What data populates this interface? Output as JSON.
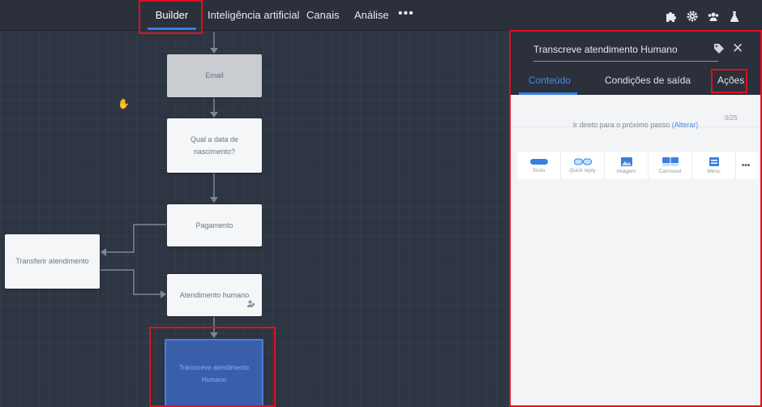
{
  "nav": {
    "items": [
      "Builder",
      "Inteligência artificial",
      "Canais",
      "Análise"
    ],
    "more": "•••",
    "icons": [
      "puzzle-icon",
      "gear-icon",
      "users-icon",
      "flask-icon"
    ]
  },
  "canvas": {
    "nodes": {
      "email": "Email",
      "nascimento": "Qual a data de nascimento?",
      "pagamento": "Pagamento",
      "transferir": "Transferir atendimento",
      "atendimento": "Atendimento humano",
      "transcreve": "Transcreve atendimento Humano"
    }
  },
  "panel": {
    "title": "Transcreve atendimento Humano",
    "tabs": [
      "Conteúdo",
      "Condições de saída",
      "Ações"
    ],
    "counter": "0/25",
    "next_step_text": "Ir direto para o próximo passo",
    "next_step_link": "(Alterar)",
    "content_types": [
      "Texto",
      "Quick reply",
      "Imagem",
      "Carrossel",
      "Menu"
    ],
    "more": "•••"
  },
  "colors": {
    "accent": "#3a80e0",
    "highlight": "#e0101e",
    "selected_node": "#3a5faa"
  }
}
